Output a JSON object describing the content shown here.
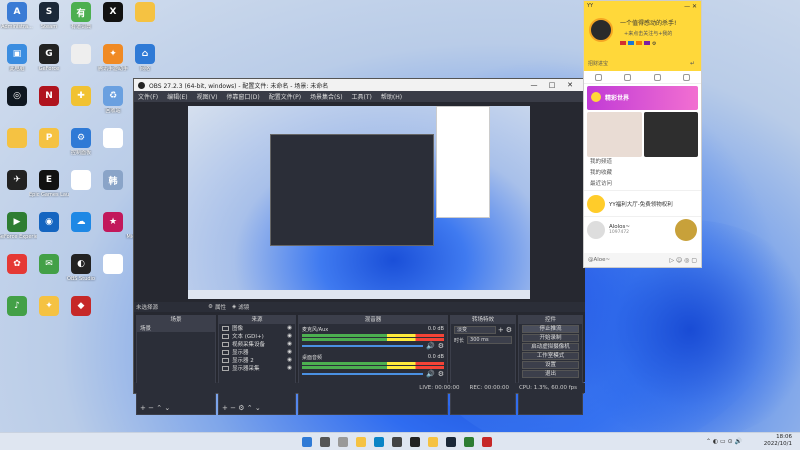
{
  "desktop": {
    "icons": [
      {
        "label": "Administra...",
        "color": "#3a7bd5",
        "glyph": "A"
      },
      {
        "label": "Steam",
        "color": "#1b2838",
        "glyph": "S"
      },
      {
        "label": "有道词典",
        "color": "#4caf50",
        "glyph": "有"
      },
      {
        "label": "",
        "color": "#111",
        "glyph": "X"
      },
      {
        "label": "",
        "color": "#f5c242",
        "glyph": ""
      },
      {
        "label": "此电脑",
        "color": "#3b8de0",
        "glyph": "▣"
      },
      {
        "label": "GeForce",
        "color": "#222",
        "glyph": "G"
      },
      {
        "label": "",
        "color": "#eee",
        "glyph": ""
      },
      {
        "label": "腾讯手游助手",
        "color": "#f08a24",
        "glyph": "✦"
      },
      {
        "label": "网络",
        "color": "#2f7ad6",
        "glyph": "⌂"
      },
      {
        "label": "",
        "color": "#0f1720",
        "glyph": "◎"
      },
      {
        "label": "",
        "color": "#b0131e",
        "glyph": "N"
      },
      {
        "label": "",
        "color": "#f1c232",
        "glyph": "✚"
      },
      {
        "label": "回收站",
        "color": "#6aa0e0",
        "glyph": "♻"
      },
      {
        "label": "",
        "color": "#f5c242",
        "glyph": ""
      },
      {
        "label": "",
        "color": "#f5c242",
        "glyph": ""
      },
      {
        "label": "",
        "color": "#f5c242",
        "glyph": "P"
      },
      {
        "label": "控制面板",
        "color": "#2f7ad6",
        "glyph": "⚙"
      },
      {
        "label": "",
        "color": "#fff",
        "glyph": ""
      },
      {
        "label": "",
        "color": "#f5c242",
        "glyph": ""
      },
      {
        "label": "",
        "color": "#222",
        "glyph": "✈"
      },
      {
        "label": "Epic Games Launcher",
        "color": "#111",
        "glyph": "E"
      },
      {
        "label": "",
        "color": "#fff",
        "glyph": ""
      },
      {
        "label": "",
        "color": "#8aa4c8",
        "glyph": "韩"
      },
      {
        "label": "",
        "color": "#111",
        "glyph": "♞"
      },
      {
        "label": "GeForce Experience",
        "color": "#2e7d32",
        "glyph": "▶"
      },
      {
        "label": "",
        "color": "#1565c0",
        "glyph": "◉"
      },
      {
        "label": "",
        "color": "#1e88e5",
        "glyph": "☁"
      },
      {
        "label": "",
        "color": "#c2185b",
        "glyph": "★"
      },
      {
        "label": "Microsoft Edge",
        "color": "#0a84c6",
        "glyph": "e"
      },
      {
        "label": "",
        "color": "#e53935",
        "glyph": "✿"
      },
      {
        "label": "",
        "color": "#43a047",
        "glyph": "✉"
      },
      {
        "label": "OBS Studio",
        "color": "#222",
        "glyph": "◐"
      },
      {
        "label": "",
        "color": "#fff",
        "glyph": ""
      },
      {
        "label": "",
        "color": "#d8a27a",
        "glyph": "☺"
      },
      {
        "label": "",
        "color": "#43a047",
        "glyph": "♪"
      },
      {
        "label": "",
        "color": "#f5c242",
        "glyph": "✦"
      },
      {
        "label": "",
        "color": "#c62828",
        "glyph": "◆"
      }
    ]
  },
  "obs": {
    "title": "OBS 27.2.3 (64-bit, windows) - 配置文件: 未命名 - 场景: 未命名",
    "window_controls": [
      "—",
      "□",
      "✕"
    ],
    "menu": [
      "文件(F)",
      "编辑(E)",
      "视图(V)",
      "停靠窗口(D)",
      "配置文件(P)",
      "场景集合(S)",
      "工具(T)",
      "帮助(H)"
    ],
    "preview_status": "未选择源",
    "preview_btns": [
      "属性",
      "滤镜"
    ],
    "docks": {
      "scenes": {
        "title": "场景",
        "items": [
          "场景"
        ]
      },
      "sources": {
        "title": "来源",
        "items": [
          "图像",
          "文本 (GDI+)",
          "视频采集设备",
          "显示器",
          "显示器 2",
          "显示器采集"
        ]
      },
      "mixer": {
        "title": "混音器",
        "tracks": [
          {
            "name": "麦克风/Aux",
            "db": "0.0 dB"
          },
          {
            "name": "桌面音频",
            "db": "0.0 dB"
          }
        ]
      },
      "transitions": {
        "title": "转场特效",
        "type": "淡变",
        "duration_label": "时长",
        "duration": "300 ms"
      },
      "controls": {
        "title": "控件",
        "buttons": [
          "停止推流",
          "开始录制",
          "启动虚拟摄像机",
          "工作室模式",
          "设置",
          "退出"
        ]
      }
    },
    "status": {
      "live": "LIVE: 00:00:00",
      "rec": "REC: 00:00:00",
      "cpu": "CPU: 1.3%, 60.00 fps"
    }
  },
  "yy": {
    "app": "YY",
    "name": "一个值得感动的杀手!",
    "signature": "+来点击关注与+我的",
    "badge_text": "招财进宝",
    "banner": "精彩世界",
    "rows": [
      "我的频道",
      "我的收藏",
      "最近访问"
    ],
    "items": [
      {
        "title": "YY福利大厅-免费领物权利",
        "sub": ""
      },
      {
        "title": "Alolos~",
        "sub": "1097472"
      }
    ],
    "footer": "@Aloe~"
  },
  "taskbar": {
    "time": "18:06",
    "date": "2022/10/1"
  }
}
